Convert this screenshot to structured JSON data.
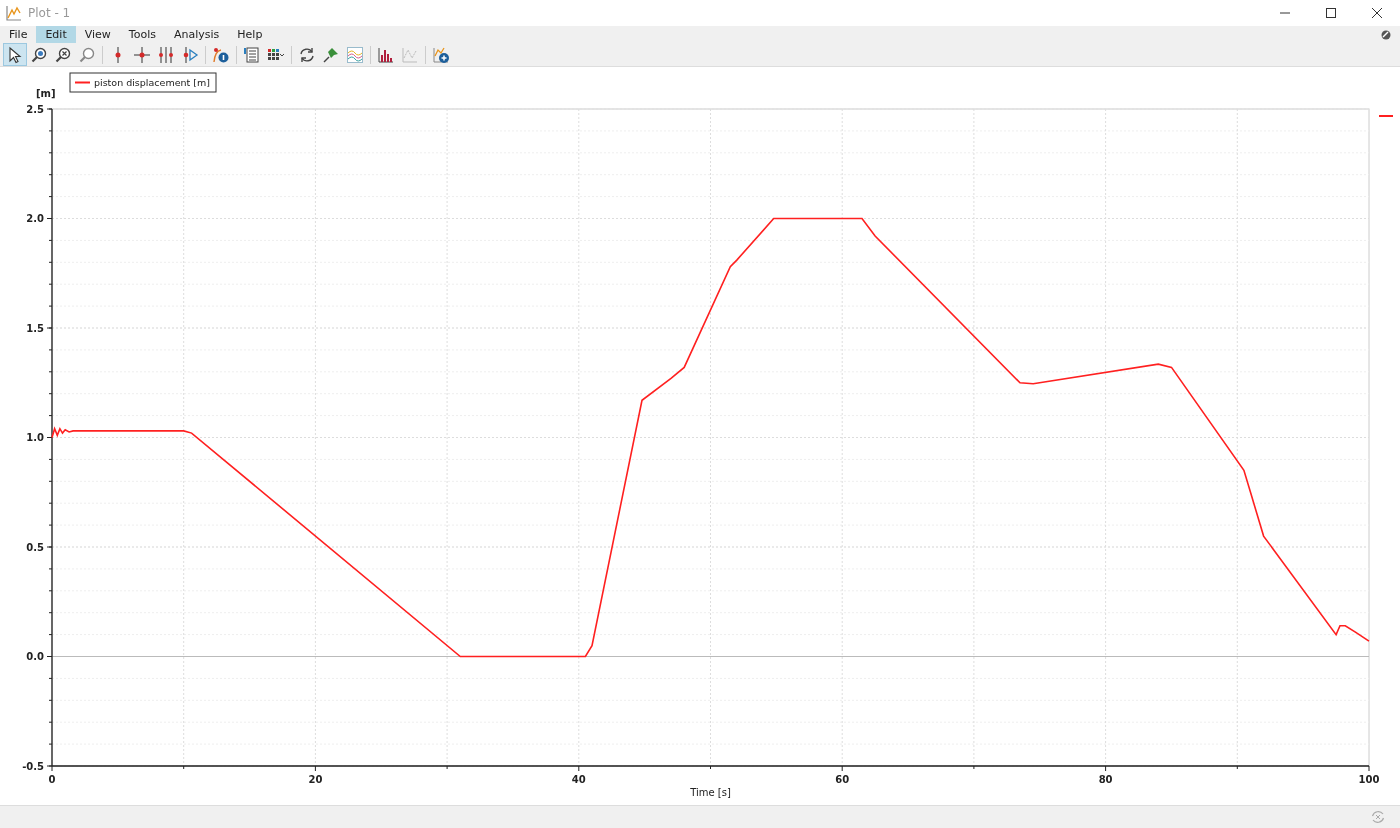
{
  "window": {
    "title": "Plot - 1"
  },
  "menu": [
    {
      "label": "File",
      "selected": false
    },
    {
      "label": "Edit",
      "selected": true
    },
    {
      "label": "View",
      "selected": false
    },
    {
      "label": "Tools",
      "selected": false
    },
    {
      "label": "Analysis",
      "selected": false
    },
    {
      "label": "Help",
      "selected": false
    }
  ],
  "toolbar": [
    {
      "kind": "pointer",
      "selected": true
    },
    {
      "kind": "zoom",
      "selected": false
    },
    {
      "kind": "zoomx",
      "selected": false
    },
    {
      "kind": "zoomr",
      "selected": false
    },
    {
      "kind": "cursor",
      "selected": false
    },
    {
      "kind": "cross",
      "selected": false
    },
    {
      "kind": "cursors",
      "selected": false
    },
    {
      "kind": "play",
      "selected": false
    },
    {
      "kind": "info",
      "selected": false
    },
    {
      "kind": "list",
      "selected": false
    },
    {
      "kind": "grid",
      "selected": false
    },
    {
      "kind": "refresh",
      "selected": false
    },
    {
      "kind": "pin",
      "selected": false
    },
    {
      "kind": "waves",
      "selected": false
    },
    {
      "kind": "hist",
      "selected": false
    },
    {
      "kind": "ghost",
      "selected": false
    },
    {
      "kind": "add",
      "selected": false
    }
  ],
  "plot": {
    "chart_data": {
      "type": "line",
      "grid": true,
      "xlabel": "Time [s]",
      "ylabel": "[m]",
      "xlim": [
        0,
        100
      ],
      "ylim": [
        -0.5,
        2.5
      ],
      "xticks": [
        0,
        20,
        40,
        60,
        80,
        100
      ],
      "yticks": [
        {
          "value": -0.5,
          "label": "-0.5"
        },
        {
          "value": 0,
          "label": "0.0"
        },
        {
          "value": 0.5,
          "label": "0.5"
        },
        {
          "value": 1,
          "label": "1.0"
        },
        {
          "value": 1.5,
          "label": "1.5"
        },
        {
          "value": 2,
          "label": "2.0"
        },
        {
          "value": 2.5,
          "label": "2.5"
        }
      ],
      "x": [
        0,
        0.2,
        0.4,
        0.6,
        0.8,
        1.0,
        1.3,
        1.6,
        10,
        10.6,
        31,
        40.5,
        41,
        44.8,
        47,
        48,
        51.5,
        52,
        54.8,
        61.5,
        62.5,
        73.5,
        74.5,
        84,
        85,
        90.5,
        91,
        92,
        97.5,
        97.8,
        98.2,
        99,
        100
      ],
      "series": [
        {
          "name": "piston displacement [m]",
          "color": "#ff2020",
          "values": [
            1.0,
            1.04,
            1.01,
            1.04,
            1.02,
            1.035,
            1.025,
            1.03,
            1.03,
            1.02,
            0,
            0,
            0.05,
            1.17,
            1.27,
            1.32,
            1.78,
            1.81,
            2.0,
            2.0,
            1.92,
            1.25,
            1.245,
            1.335,
            1.32,
            0.85,
            0.75,
            0.55,
            0.1,
            0.14,
            0.14,
            0.11,
            0.07
          ]
        }
      ]
    }
  }
}
